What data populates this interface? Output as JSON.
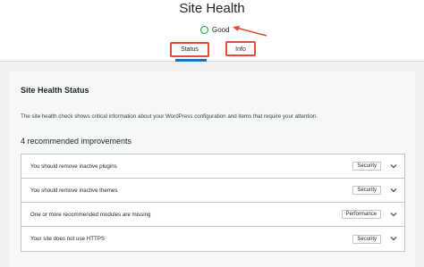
{
  "header": {
    "title": "Site Health",
    "status_text": "Good",
    "status_color": "#00a32a",
    "tabs": [
      {
        "label": "Status",
        "active": true
      },
      {
        "label": "Info",
        "active": false
      }
    ],
    "annotation_color": "#e34c36"
  },
  "main": {
    "section_title": "Site Health Status",
    "description": "The site health check shows critical information about your WordPress configuration and items that require your attention.",
    "improvements_heading": "4 recommended improvements",
    "items": [
      {
        "label": "You should remove inactive plugins",
        "badge": "Security",
        "icon": "chevron-down-icon"
      },
      {
        "label": "You should remove inactive themes",
        "badge": "Security",
        "icon": "chevron-down-icon"
      },
      {
        "label": "One or more recommended modules are missing",
        "badge": "Performance",
        "icon": "chevron-down-icon"
      },
      {
        "label": "Your site does not use HTTPS",
        "badge": "Security",
        "icon": "chevron-down-icon"
      }
    ]
  }
}
